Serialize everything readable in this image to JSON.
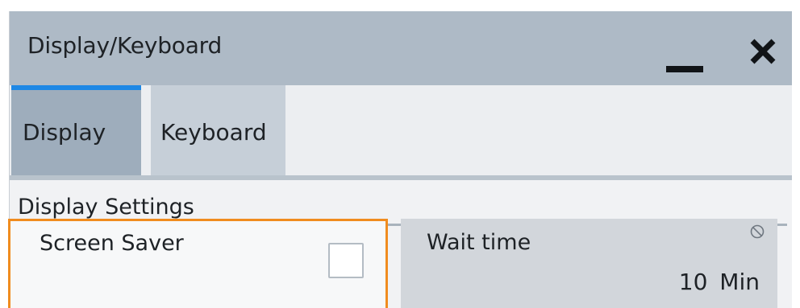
{
  "window": {
    "title": "Display/Keyboard",
    "minimize_icon": "minimize-icon",
    "close_icon": "close-icon"
  },
  "tabs": [
    {
      "label": "Display",
      "active": true
    },
    {
      "label": "Keyboard",
      "active": false
    }
  ],
  "section": {
    "title": "Display Settings"
  },
  "screen_saver": {
    "label": "Screen Saver",
    "checked": false
  },
  "wait_time": {
    "label": "Wait time",
    "value": "10 Min",
    "status_icon": "disabled-icon"
  },
  "colors": {
    "titlebar": "#aebac6",
    "active_tab": "#9eadbc",
    "tab_accent": "#1e88e5",
    "focus_border": "#f08c1f",
    "disabled_field": "#d2d6db"
  }
}
